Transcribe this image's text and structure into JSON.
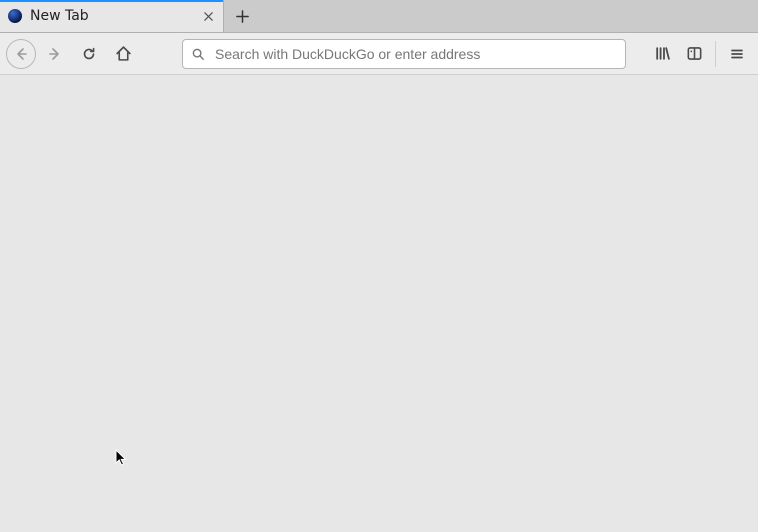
{
  "tabs": [
    {
      "title": "New Tab"
    }
  ],
  "urlbar": {
    "placeholder": "Search with DuckDuckGo or enter address",
    "value": ""
  }
}
